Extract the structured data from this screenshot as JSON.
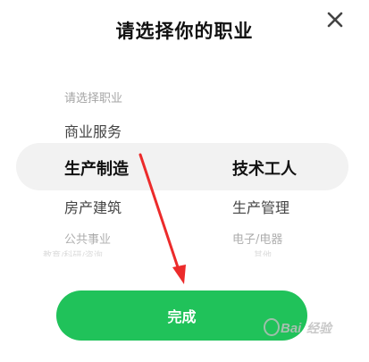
{
  "dialog": {
    "title": "请选择你的职业",
    "close_icon": "close-icon",
    "done_label": "完成"
  },
  "picker": {
    "col1": [
      "请选择职业",
      "商业服务",
      "生产制造",
      "房产建筑",
      "公共事业",
      "教育/科研/咨询"
    ],
    "col2": [
      "技术工人",
      "生产管理",
      "电子/电器",
      "其他"
    ],
    "selected": {
      "col1": "生产制造",
      "col2": "技术工人"
    }
  },
  "annotation": {
    "arrow_color": "#ec2b2b"
  },
  "watermark": {
    "text": "Baidu经验"
  },
  "colors": {
    "accent": "#20c25a",
    "highlight": "#f2f2f2"
  }
}
